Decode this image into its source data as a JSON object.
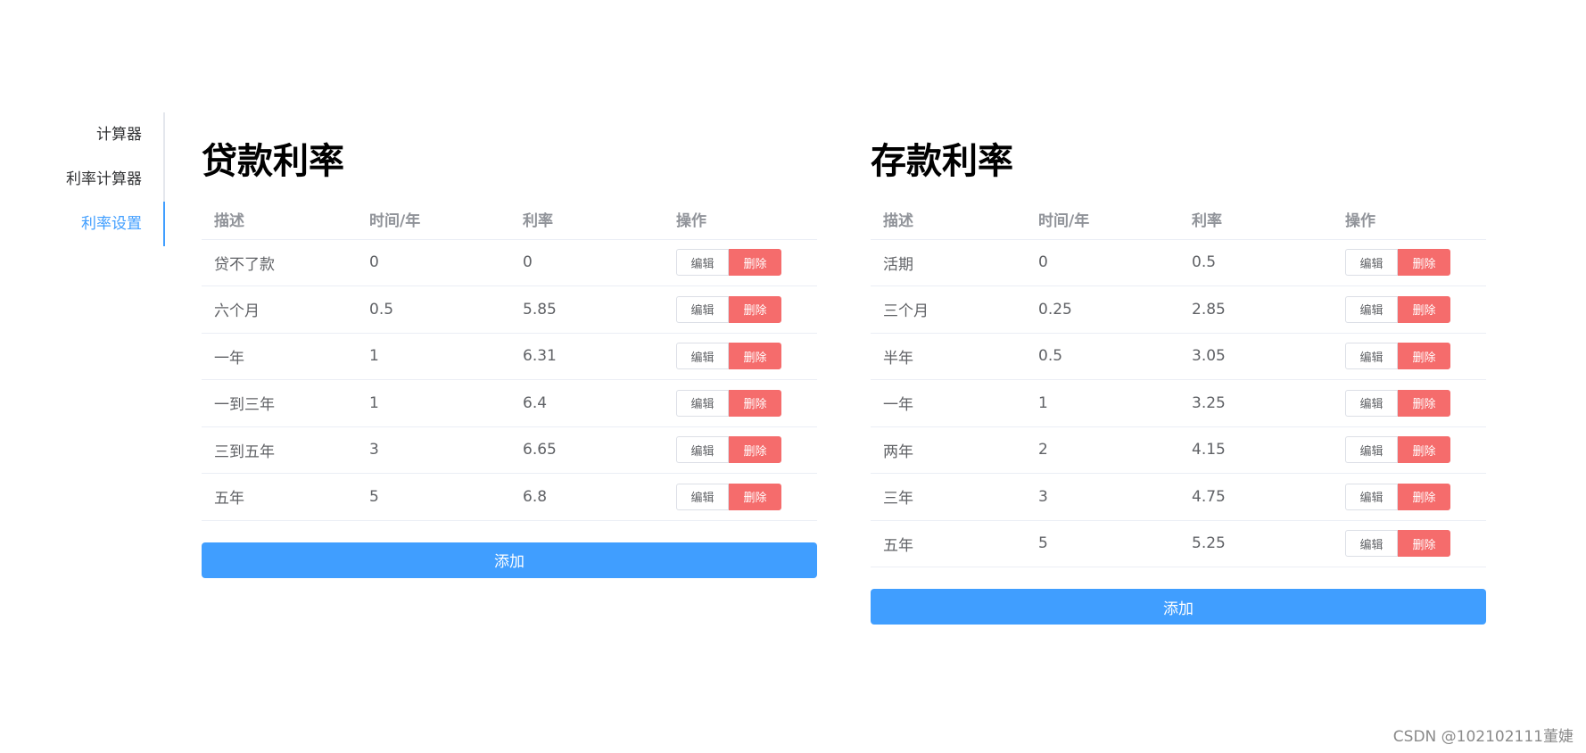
{
  "sidebar": {
    "tabs": [
      {
        "label": "计算器"
      },
      {
        "label": "利率计算器"
      },
      {
        "label": "利率设置",
        "active": true
      }
    ]
  },
  "colors": {
    "primary": "#409eff",
    "danger": "#f56c6c",
    "header_text": "#909399",
    "body_text": "#606266"
  },
  "loan": {
    "title": "贷款利率",
    "columns": [
      "描述",
      "时间/年",
      "利率",
      "操作"
    ],
    "rows": [
      {
        "desc": "贷不了款",
        "years": "0",
        "rate": "0"
      },
      {
        "desc": "六个月",
        "years": "0.5",
        "rate": "5.85"
      },
      {
        "desc": "一年",
        "years": "1",
        "rate": "6.31"
      },
      {
        "desc": "一到三年",
        "years": "1",
        "rate": "6.4"
      },
      {
        "desc": "三到五年",
        "years": "3",
        "rate": "6.65"
      },
      {
        "desc": "五年",
        "years": "5",
        "rate": "6.8"
      }
    ],
    "edit_label": "编辑",
    "delete_label": "删除",
    "add_label": "添加"
  },
  "deposit": {
    "title": "存款利率",
    "columns": [
      "描述",
      "时间/年",
      "利率",
      "操作"
    ],
    "rows": [
      {
        "desc": "活期",
        "years": "0",
        "rate": "0.5"
      },
      {
        "desc": "三个月",
        "years": "0.25",
        "rate": "2.85"
      },
      {
        "desc": "半年",
        "years": "0.5",
        "rate": "3.05"
      },
      {
        "desc": "一年",
        "years": "1",
        "rate": "3.25"
      },
      {
        "desc": "两年",
        "years": "2",
        "rate": "4.15"
      },
      {
        "desc": "三年",
        "years": "3",
        "rate": "4.75"
      },
      {
        "desc": "五年",
        "years": "5",
        "rate": "5.25"
      }
    ],
    "edit_label": "编辑",
    "delete_label": "删除",
    "add_label": "添加"
  },
  "watermark": "CSDN @102102111董婕"
}
